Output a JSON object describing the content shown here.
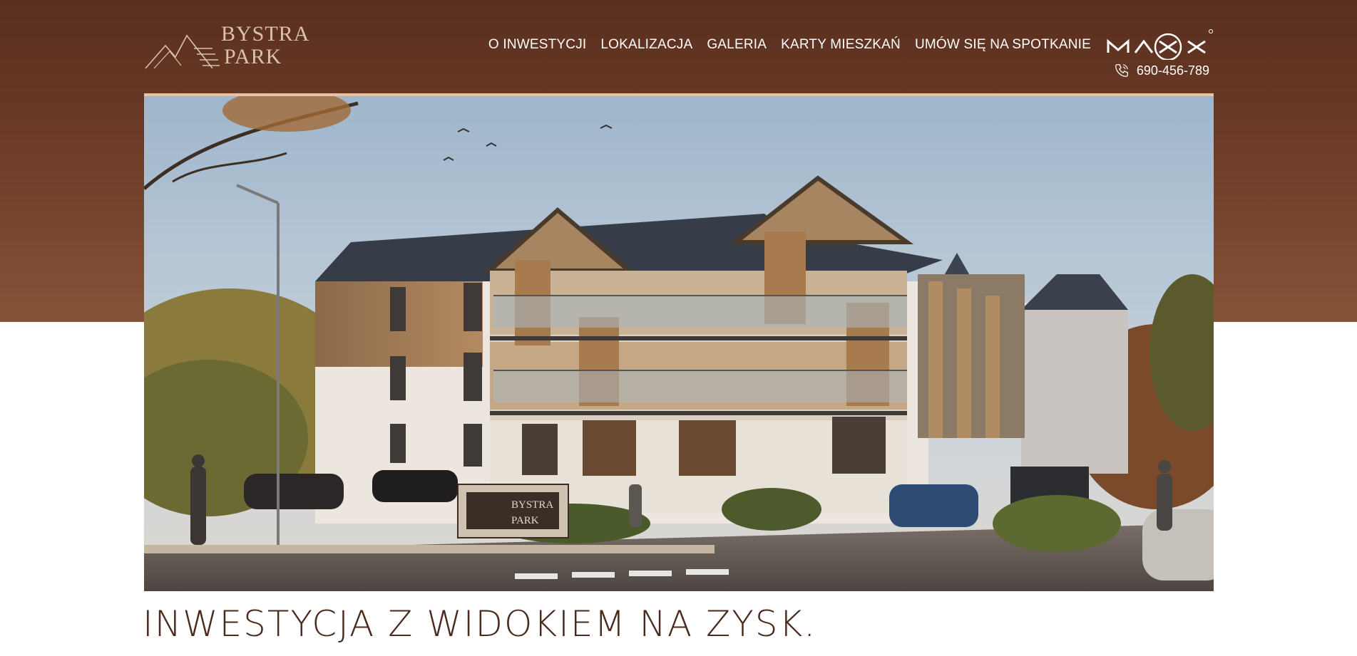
{
  "brand": {
    "logo_line1": "BYSTRA",
    "logo_line2": "PARK",
    "partner_logo": "MAXX"
  },
  "nav": {
    "items": [
      {
        "label": "O INWESTYCJI"
      },
      {
        "label": "LOKALIZACJA"
      },
      {
        "label": "GALERIA"
      },
      {
        "label": "KARTY MIESZKAŃ"
      },
      {
        "label": "UMÓW SIĘ NA SPOTKANIE"
      }
    ]
  },
  "contact": {
    "phone": "690-456-789",
    "icon": "phone-icon"
  },
  "hero": {
    "sign_line1": "BYSTRA",
    "sign_line2": "PARK",
    "tagline": "INWESTYCJA Z WIDOKIEM NA ZYSK."
  },
  "colors": {
    "header_bg": "#5a2f1f",
    "accent": "#e6c3a3",
    "tagline": "#4a2a1e"
  }
}
